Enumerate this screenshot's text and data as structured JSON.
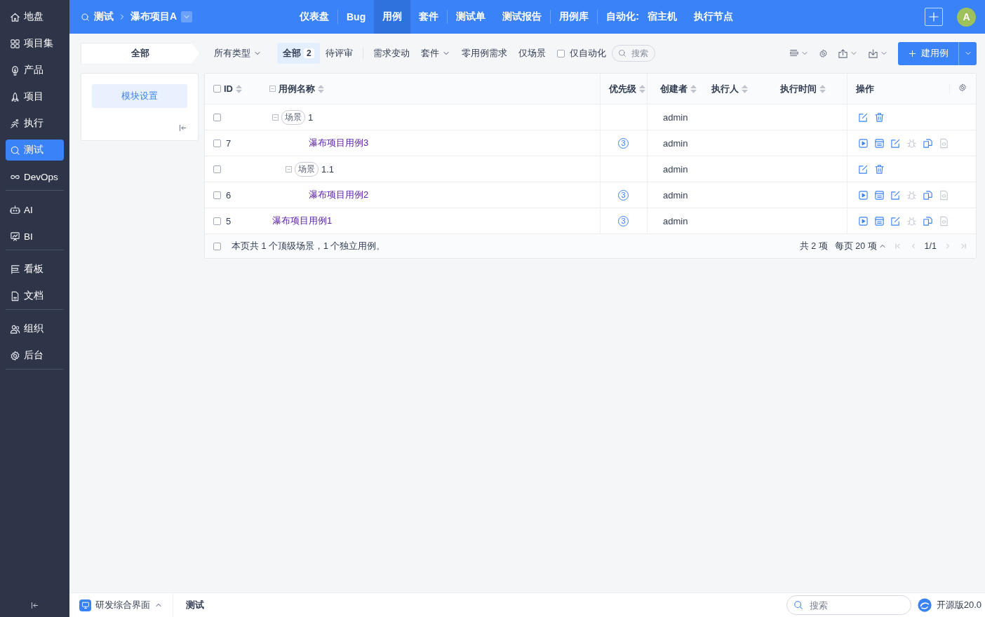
{
  "sidebar": {
    "groups": [
      [
        {
          "label": "地盘",
          "selected": false
        },
        {
          "label": "项目集",
          "selected": false
        },
        {
          "label": "产品",
          "selected": false
        },
        {
          "label": "项目",
          "selected": false
        },
        {
          "label": "执行",
          "selected": false
        },
        {
          "label": "测试",
          "selected": true
        },
        {
          "label": "DevOps",
          "selected": false
        }
      ],
      [
        {
          "label": "AI",
          "selected": false
        },
        {
          "label": "BI",
          "selected": false
        }
      ],
      [
        {
          "label": "看板",
          "selected": false
        },
        {
          "label": "文档",
          "selected": false
        }
      ],
      [
        {
          "label": "组织",
          "selected": false
        },
        {
          "label": "后台",
          "selected": false
        }
      ]
    ]
  },
  "header": {
    "section": "测试",
    "project": "瀑布项目A",
    "nav_groups": [
      {
        "items": [
          {
            "label": "仪表盘",
            "selected": false
          }
        ]
      },
      {
        "items": [
          {
            "label": "Bug",
            "selected": false
          },
          {
            "label": "用例",
            "selected": true
          },
          {
            "label": "套件",
            "selected": false
          }
        ]
      },
      {
        "items": [
          {
            "label": "测试单",
            "selected": false
          },
          {
            "label": "测试报告",
            "selected": false
          }
        ]
      },
      {
        "items": [
          {
            "label": "用例库",
            "selected": false
          }
        ]
      },
      {
        "prefix": "自动化:",
        "items": [
          {
            "label": "宿主机",
            "selected": false
          },
          {
            "label": "执行节点",
            "selected": false
          }
        ]
      }
    ],
    "avatar": "A"
  },
  "module_panel": {
    "tab": "全部",
    "button": "模块设置"
  },
  "toolbar": {
    "type_filter": "所有类型",
    "status_tabs": [
      {
        "label": "全部",
        "count": "2",
        "selected": true
      },
      {
        "label": "待评审",
        "selected": false
      }
    ],
    "filters": [
      {
        "label": "需求变动",
        "dropdown": false
      },
      {
        "label": "套件",
        "dropdown": true
      },
      {
        "label": "零用例需求",
        "dropdown": false
      },
      {
        "label": "仅场景",
        "dropdown": false
      }
    ],
    "auto_only": {
      "label": "仅自动化",
      "checked": false
    },
    "search": {
      "placeholder": "搜索"
    },
    "create_button": "建用例"
  },
  "table": {
    "columns": [
      {
        "label": "ID",
        "sortable": true
      },
      {
        "label": "用例名称",
        "sortable": true
      },
      {
        "label": "优先级",
        "sortable": true
      },
      {
        "label": "创建者",
        "sortable": true
      },
      {
        "label": "执行人",
        "sortable": true
      },
      {
        "label": "执行时间",
        "sortable": true
      },
      {
        "label": "操作",
        "sortable": false
      }
    ],
    "rows": [
      {
        "kind": "scene",
        "tag": "场景",
        "title": "1",
        "creator": "admin",
        "checked": false,
        "actions": [
          {
            "kind": "edit",
            "disabled": false
          },
          {
            "kind": "delete",
            "disabled": false
          }
        ],
        "children": [
          {
            "kind": "case",
            "id": "7",
            "title": "瀑布项目用例3",
            "priority": "3",
            "creator": "admin",
            "checked": false,
            "actions": [
              {
                "kind": "run",
                "disabled": false
              },
              {
                "kind": "results",
                "disabled": false
              },
              {
                "kind": "edit",
                "disabled": false
              },
              {
                "kind": "bug",
                "disabled": true
              },
              {
                "kind": "copy",
                "disabled": false
              },
              {
                "kind": "script",
                "disabled": true
              }
            ]
          },
          {
            "kind": "scene",
            "tag": "场景",
            "title": "1.1",
            "creator": "admin",
            "checked": false,
            "actions": [
              {
                "kind": "edit",
                "disabled": false
              },
              {
                "kind": "delete",
                "disabled": false
              }
            ],
            "children": [
              {
                "kind": "case",
                "id": "6",
                "title": "瀑布项目用例2",
                "priority": "3",
                "creator": "admin",
                "checked": false,
                "actions": [
                  {
                    "kind": "run",
                    "disabled": false
                  },
                  {
                    "kind": "results",
                    "disabled": false
                  },
                  {
                    "kind": "edit",
                    "disabled": false
                  },
                  {
                    "kind": "bug",
                    "disabled": true
                  },
                  {
                    "kind": "copy",
                    "disabled": false
                  },
                  {
                    "kind": "script",
                    "disabled": true
                  }
                ]
              }
            ]
          }
        ]
      },
      {
        "kind": "case",
        "id": "5",
        "title": "瀑布项目用例1",
        "priority": "3",
        "creator": "admin",
        "checked": false,
        "actions": [
          {
            "kind": "run",
            "disabled": false
          },
          {
            "kind": "results",
            "disabled": false
          },
          {
            "kind": "edit",
            "disabled": false
          },
          {
            "kind": "bug",
            "disabled": true
          },
          {
            "kind": "copy",
            "disabled": false
          },
          {
            "kind": "script",
            "disabled": true
          }
        ]
      }
    ],
    "select_all": {
      "checked": false
    },
    "footer": {
      "checked": false,
      "summary": "本页共 1 个顶级场景，1 个独立用例。",
      "total": "共 2 项",
      "per_page": "每页 20 项",
      "page": "1/1"
    }
  },
  "bottom_bar": {
    "app": "研发综合界面",
    "crumb": "测试",
    "search": {
      "placeholder": "搜索"
    },
    "version": "开源版20.0"
  }
}
